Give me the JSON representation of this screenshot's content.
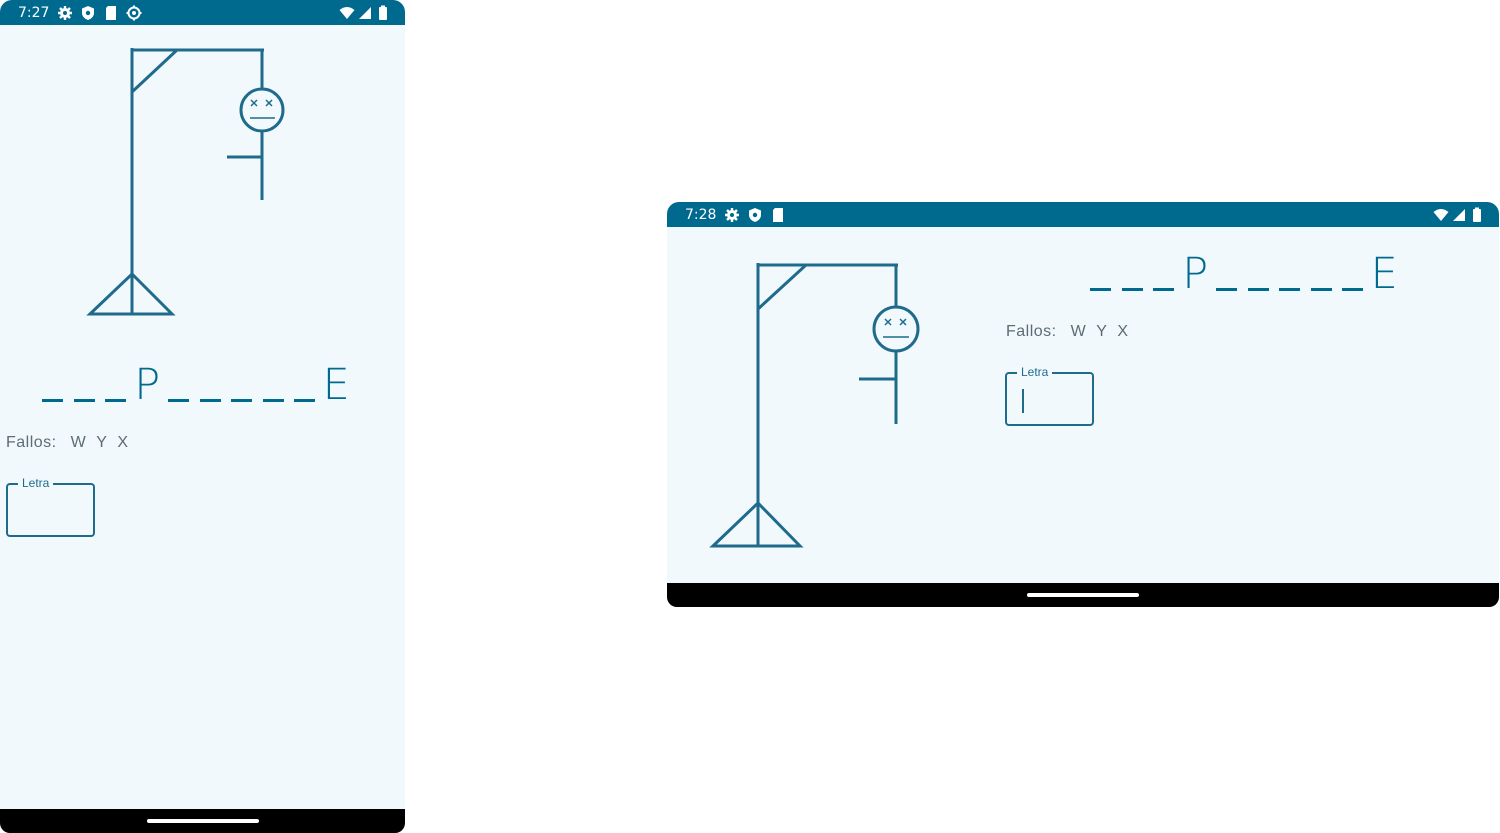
{
  "portrait": {
    "status": {
      "time": "7:27",
      "icons": [
        "gear-icon",
        "shield-icon",
        "sd-card-icon",
        "settings-cog-icon"
      ],
      "right_icons": [
        "wifi-icon",
        "signal-icon",
        "battery-icon"
      ]
    },
    "word": [
      "_",
      "_",
      "_",
      "P",
      "_",
      "_",
      "_",
      "_",
      "_",
      "E"
    ],
    "fallos_label": "Fallos:",
    "misses": [
      "W",
      "Y",
      "X"
    ],
    "input": {
      "label": "Letra",
      "value": ""
    }
  },
  "landscape": {
    "status": {
      "time": "7:28",
      "icons": [
        "gear-icon",
        "shield-icon",
        "sd-card-icon"
      ],
      "right_icons": [
        "wifi-icon",
        "signal-icon",
        "battery-icon"
      ]
    },
    "word": [
      "_",
      "_",
      "_",
      "P",
      "_",
      "_",
      "_",
      "_",
      "_",
      "E"
    ],
    "fallos_label": "Fallos:",
    "misses": [
      "W",
      "Y",
      "X"
    ],
    "input": {
      "label": "Letra",
      "value": ""
    }
  },
  "colors": {
    "primary": "#006a8e",
    "background": "#f1f9fd",
    "text_muted": "#5d6c74"
  }
}
